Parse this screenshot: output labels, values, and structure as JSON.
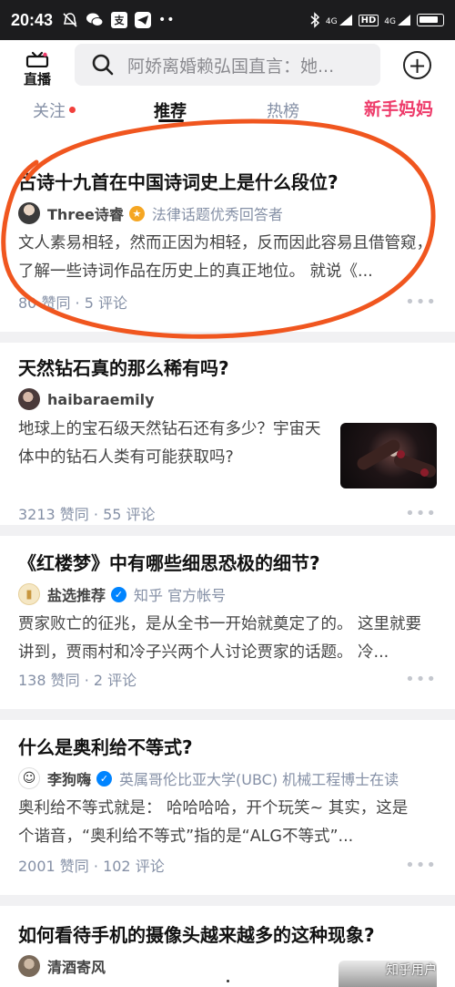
{
  "status_bar": {
    "time": "20:43",
    "left_icons": [
      "mute-icon",
      "wechat-icon",
      "alipay-icon",
      "telegram-icon",
      "more-dots-icon"
    ],
    "right_icons": [
      "bluetooth-icon",
      "signal-4g-icon",
      "hd-icon",
      "signal-4g-icon",
      "battery-icon"
    ],
    "net1": "4G",
    "net2": "HD",
    "net3": "4G"
  },
  "header": {
    "live_label": "直播",
    "search_placeholder": "阿娇离婚赖弘国直言：她...",
    "plus_icon": "plus-circle-icon"
  },
  "tabs": [
    {
      "label": "关注",
      "has_dot": true
    },
    {
      "label": "推荐",
      "active": true
    },
    {
      "label": "热榜"
    },
    {
      "label": "新手妈妈",
      "brand": true
    }
  ],
  "colors": {
    "accent_blue": "#0084ff",
    "brand_pink": "#ee3b6a",
    "annotation_orange": "#f0561f",
    "meta_gray": "#8590a6"
  },
  "feed": [
    {
      "title": "古诗十九首在中国诗词史上是什么段位?",
      "author": "Three诗睿",
      "badge": "gold",
      "author_title": "法律话题优秀回答者",
      "excerpt": "文人素易相轻，然而正因为相轻，反而因此容易且借管窥，了解一些诗词作品在历史上的真正地位。 就说《...",
      "meta": "80 赞同 · 5 评论"
    },
    {
      "title": "天然钻石真的那么稀有吗?",
      "author": "haibaraemily",
      "excerpt": "地球上的宝石级天然钻石还有多少？宇宙天体中的钻石人类有可能获取吗?",
      "meta": "3213 赞同 · 55 评论",
      "has_thumbnail": true
    },
    {
      "title": "《红楼梦》中有哪些细思恐极的细节?",
      "author": "盐选推荐",
      "badge": "blue",
      "author_title": "知乎 官方帐号",
      "excerpt": "贾家败亡的征兆，是从全书一开始就奠定了的。 这里就要讲到，贾雨村和冷子兴两个人讨论贾家的话题。 冷...",
      "meta": "138 赞同 · 2 评论"
    },
    {
      "title": "什么是奥利给不等式?",
      "author": "李狗嗨",
      "badge": "blue",
      "author_title": "英属哥伦比亚大学(UBC) 机械工程博士在读",
      "excerpt": "奥利给不等式就是： 哈哈哈哈，开个玩笑~ 其实，这是个谐音，“奥利给不等式”指的是“ALG不等式”...",
      "meta": "2001 赞同 · 102 评论"
    },
    {
      "title": "如何看待手机的摄像头越来越多的这种现象?",
      "author": "清酒寄风"
    }
  ],
  "watermark": "知乎用户"
}
